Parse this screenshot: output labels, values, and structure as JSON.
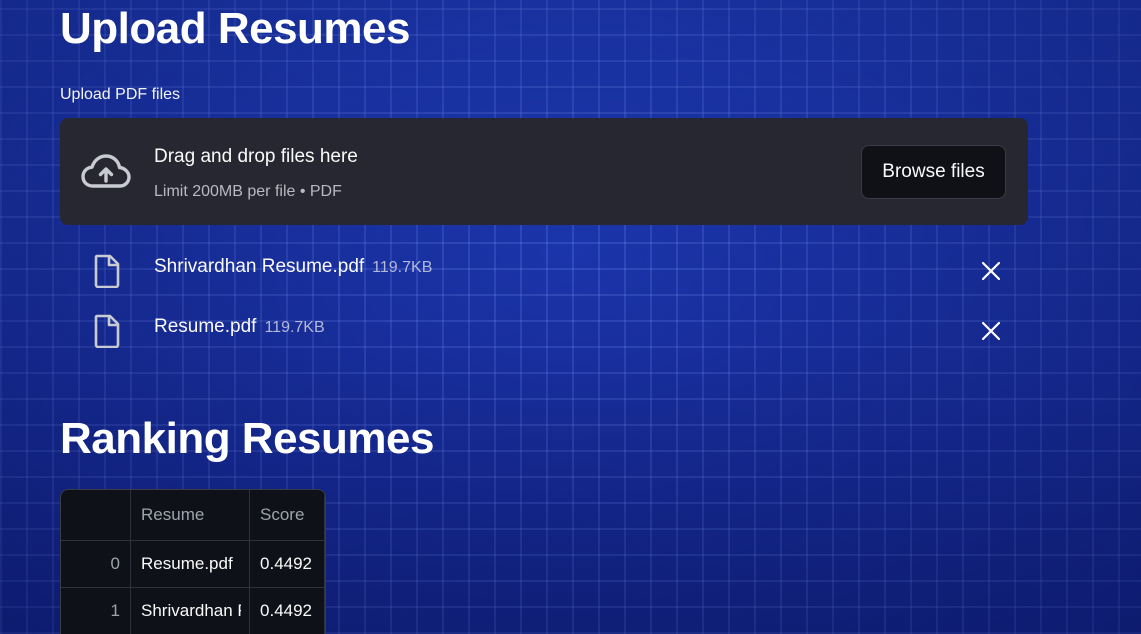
{
  "upload_section": {
    "title": "Upload Resumes",
    "field_label": "Upload PDF files",
    "dropzone": {
      "title": "Drag and drop files here",
      "subtitle": "Limit 200MB per file • PDF",
      "browse_label": "Browse files",
      "icon": "cloud-upload-icon"
    },
    "files": [
      {
        "name": "Shrivardhan Resume.pdf",
        "size": "119.7KB",
        "icon": "file-icon",
        "remove_icon": "close-icon"
      },
      {
        "name": "Resume.pdf",
        "size": "119.7KB",
        "icon": "file-icon",
        "remove_icon": "close-icon"
      }
    ]
  },
  "ranking_section": {
    "title": "Ranking Resumes",
    "table": {
      "columns": [
        "",
        "Resume",
        "Score"
      ],
      "rows": [
        {
          "index": "0",
          "resume": "Resume.pdf",
          "score": "0.4492"
        },
        {
          "index": "1",
          "resume": "Shrivardhan Resume.pdf",
          "score": "0.4492"
        }
      ]
    }
  },
  "colors": {
    "background": "#1c35a8",
    "dropzone": "#262730",
    "table_bg": "#0e1117",
    "text": "#fafafa"
  }
}
